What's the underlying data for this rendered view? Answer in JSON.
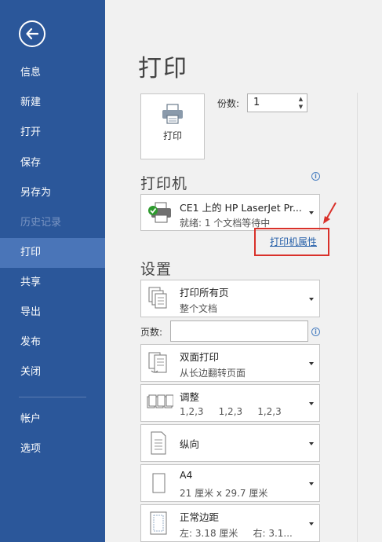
{
  "sidebar": {
    "items": [
      {
        "label": "信息"
      },
      {
        "label": "新建"
      },
      {
        "label": "打开"
      },
      {
        "label": "保存"
      },
      {
        "label": "另存为"
      },
      {
        "label": "历史记录"
      },
      {
        "label": "打印"
      },
      {
        "label": "共享"
      },
      {
        "label": "导出"
      },
      {
        "label": "发布"
      },
      {
        "label": "关闭"
      },
      {
        "label": "帐户"
      },
      {
        "label": "选项"
      }
    ]
  },
  "main": {
    "title": "打印",
    "print_button_label": "打印",
    "copies_label": "份数:",
    "copies_value": "1",
    "printer_section_title": "打印机",
    "printer": {
      "name": "CE1 上的 HP LaserJet Pr...",
      "status": "就绪: 1 个文档等待中"
    },
    "printer_properties_link": "打印机属性",
    "settings_section_title": "设置",
    "settings": [
      {
        "line1": "打印所有页",
        "line2": "整个文档"
      },
      {
        "line1": "双面打印",
        "line2": "从长边翻转页面"
      },
      {
        "line1": "调整",
        "line2": "1,2,3     1,2,3     1,2,3"
      },
      {
        "line1": "纵向",
        "line2": ""
      },
      {
        "line1": "A4",
        "line2": "21 厘米 x 29.7 厘米"
      },
      {
        "line1": "正常边距",
        "line2": "左: 3.18 厘米     右: 3.1..."
      }
    ],
    "pages_label": "页数:",
    "pages_value": ""
  },
  "colors": {
    "sidebar_bg": "#2b579a",
    "sidebar_active": "#4a75b8",
    "highlight_box": "#d9312a",
    "link": "#2660a9"
  }
}
